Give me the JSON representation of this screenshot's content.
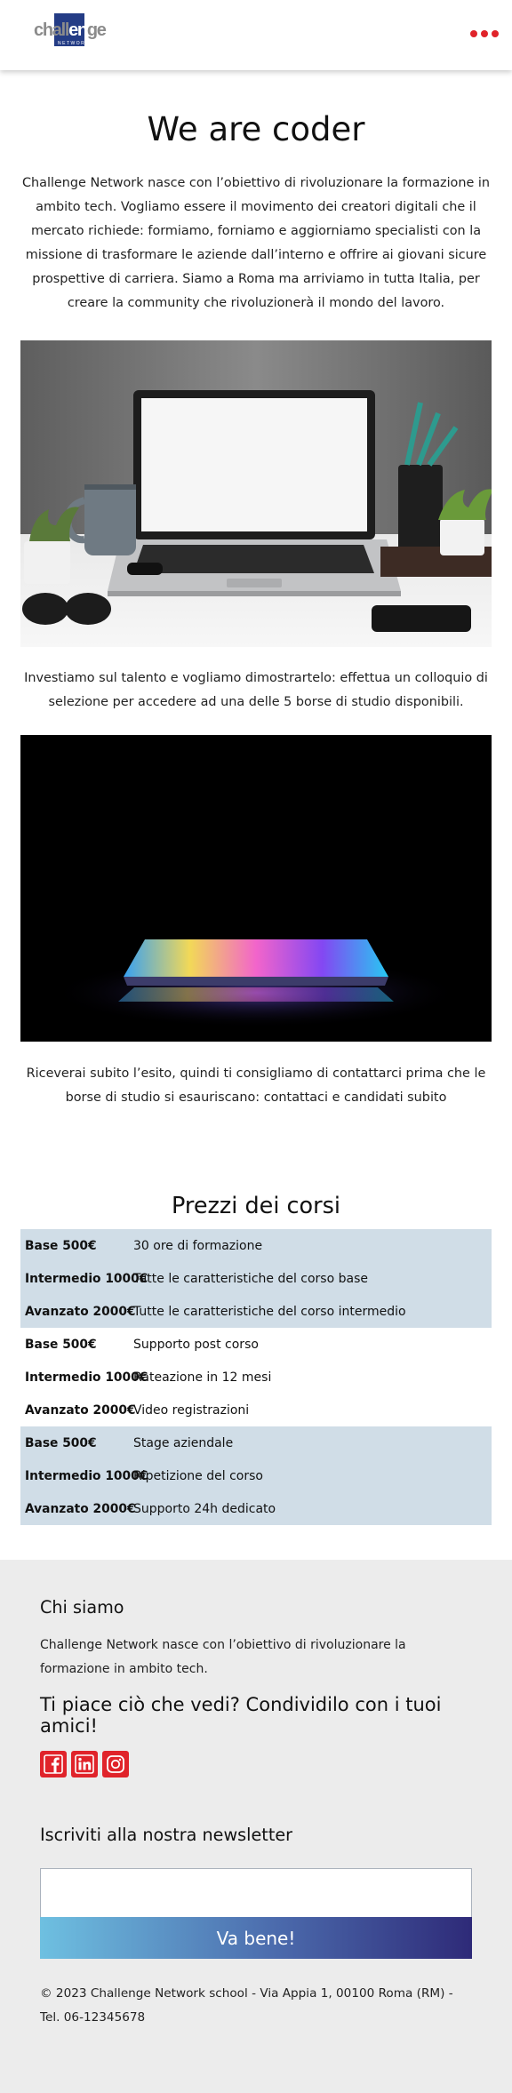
{
  "header": {
    "logo_text_start": "chall",
    "logo_text_mid": "en",
    "logo_text_end": "ge",
    "logo_subtext": "NETWORK",
    "menu_icon": "more-dots-icon"
  },
  "intro": {
    "title": "We are coder",
    "paragraph": "Challenge Network nasce con l’obiettivo di rivoluzionare la formazione in ambito tech. Vogliamo essere il movimento dei creatori digitali che il mercato richiede: formiamo, forniamo e aggiorniamo specialisti con la missione di trasformare le aziende dall’interno e offrire ai giovani sicure prospettive di carriera. Siamo a Roma ma arriviamo in tutta Italia, per creare la community che rivoluzionerà il mondo del lavoro."
  },
  "section2": {
    "text": "Investiamo sul talento e vogliamo dimostrartelo: effettua un colloquio di selezione per accedere ad una delle 5 borse di studio disponibili."
  },
  "section3": {
    "text": "Riceverai subito l’esito, quindi ti consigliamo di contattarci prima che le borse di studio si esauriscano: contattaci e candidati subito"
  },
  "prices": {
    "title": "Prezzi dei corsi",
    "groups": [
      {
        "shaded": true,
        "rows": [
          {
            "name": "Base 500€",
            "desc": "30 ore di formazione"
          },
          {
            "name": "Intermedio 1000€",
            "desc": "Tutte le caratteristiche del corso base"
          },
          {
            "name": "Avanzato 2000€",
            "desc": "Tutte le caratteristiche del corso intermedio"
          }
        ]
      },
      {
        "shaded": false,
        "rows": [
          {
            "name": "Base 500€",
            "desc": "Supporto post corso"
          },
          {
            "name": "Intermedio 1000€",
            "desc": "Rateazione in 12 mesi"
          },
          {
            "name": "Avanzato 2000€",
            "desc": "Video registrazioni"
          }
        ]
      },
      {
        "shaded": true,
        "rows": [
          {
            "name": "Base 500€",
            "desc": "Stage aziendale"
          },
          {
            "name": "Intermedio 1000€",
            "desc": "Ripetizione del corso"
          },
          {
            "name": "Avanzato 2000€",
            "desc": "Supporto 24h dedicato"
          }
        ]
      }
    ]
  },
  "footer": {
    "about_title": "Chi siamo",
    "about_text": "Challenge Network nasce con l’obiettivo di rivoluzionare la formazione in ambito tech.",
    "share_title": "Ti piace ciò che vedi? Condividilo con i tuoi amici!",
    "socials": [
      "facebook-icon",
      "linkedin-icon",
      "instagram-icon"
    ],
    "newsletter_title": "Iscriviti alla nostra newsletter",
    "newsletter_placeholder": "",
    "newsletter_button": "Va bene!",
    "copyright": "© 2023 Challenge Network school - Via Appia 1, 00100 Roma (RM) - Tel. 06-12345678"
  },
  "colors": {
    "accent_red": "#e0232a",
    "logo_blue": "#243c85",
    "table_shade": "#d0dde7",
    "footer_bg": "#ececec",
    "button_gradient_start": "#6ec0e1",
    "button_gradient_end": "#2e2a78"
  }
}
